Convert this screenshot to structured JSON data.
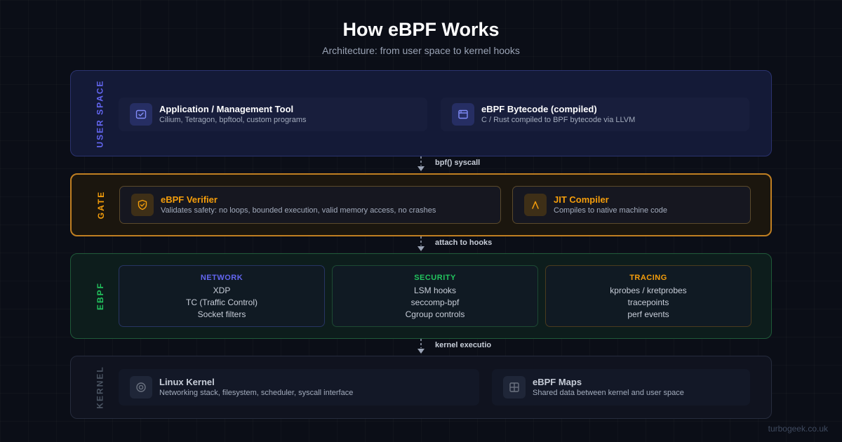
{
  "header": {
    "title": "How eBPF Works",
    "subtitle": "Architecture: from user space to kernel hooks"
  },
  "layers": {
    "user": {
      "label": "USER SPACE",
      "cards": [
        {
          "icon": "terminal-icon",
          "title": "Application / Management Tool",
          "desc": "Cilium, Tetragon, bpftool, custom programs"
        },
        {
          "icon": "window-icon",
          "title": "eBPF Bytecode (compiled)",
          "desc": "C / Rust compiled to BPF bytecode via LLVM"
        }
      ]
    },
    "gate": {
      "label": "GATE",
      "cards": [
        {
          "icon": "shield-check-icon",
          "title": "eBPF Verifier",
          "desc": "Validates safety: no loops, bounded execution, valid memory access, no crashes"
        },
        {
          "icon": "lambda-icon",
          "title": "JIT Compiler",
          "desc": "Compiles to native machine code"
        }
      ]
    },
    "ebpf": {
      "label": "EBPF",
      "categories": [
        {
          "name": "NETWORK",
          "items": [
            "XDP",
            "TC (Traffic Control)",
            "Socket filters"
          ]
        },
        {
          "name": "SECURITY",
          "items": [
            "LSM hooks",
            "seccomp-bpf",
            "Cgroup controls"
          ]
        },
        {
          "name": "TRACING",
          "items": [
            "kprobes / kretprobes",
            "tracepoints",
            "perf events"
          ]
        }
      ]
    },
    "kernel": {
      "label": "KERNEL",
      "cards": [
        {
          "icon": "target-icon",
          "title": "Linux Kernel",
          "desc": "Networking stack, filesystem, scheduler, syscall interface"
        },
        {
          "icon": "grid-icon",
          "title": "eBPF Maps",
          "desc": "Shared data between kernel and user space"
        }
      ]
    }
  },
  "connectors": [
    "bpf() syscall",
    "attach to hooks",
    "kernel executio"
  ],
  "footer": "turbogeek.co.uk",
  "colors": {
    "user_accent": "#6366f1",
    "gate_accent": "#f59e0b",
    "ebpf_accent": "#22c55e",
    "kernel_accent": "#4b5563",
    "background": "#0b0e17"
  }
}
